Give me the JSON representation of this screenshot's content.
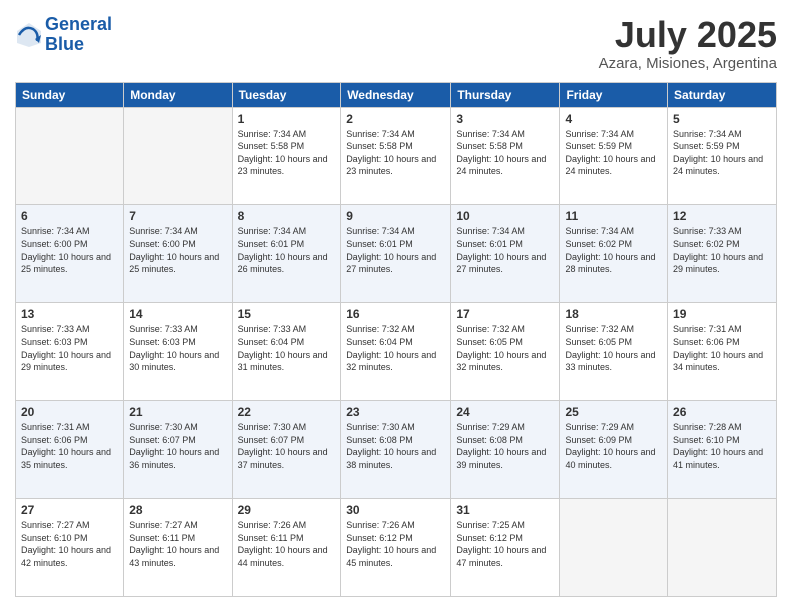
{
  "header": {
    "logo_line1": "General",
    "logo_line2": "Blue",
    "title": "July 2025",
    "subtitle": "Azara, Misiones, Argentina"
  },
  "days_of_week": [
    "Sunday",
    "Monday",
    "Tuesday",
    "Wednesday",
    "Thursday",
    "Friday",
    "Saturday"
  ],
  "weeks": [
    [
      {
        "day": "",
        "info": ""
      },
      {
        "day": "",
        "info": ""
      },
      {
        "day": "1",
        "info": "Sunrise: 7:34 AM\nSunset: 5:58 PM\nDaylight: 10 hours\nand 23 minutes."
      },
      {
        "day": "2",
        "info": "Sunrise: 7:34 AM\nSunset: 5:58 PM\nDaylight: 10 hours\nand 23 minutes."
      },
      {
        "day": "3",
        "info": "Sunrise: 7:34 AM\nSunset: 5:58 PM\nDaylight: 10 hours\nand 24 minutes."
      },
      {
        "day": "4",
        "info": "Sunrise: 7:34 AM\nSunset: 5:59 PM\nDaylight: 10 hours\nand 24 minutes."
      },
      {
        "day": "5",
        "info": "Sunrise: 7:34 AM\nSunset: 5:59 PM\nDaylight: 10 hours\nand 24 minutes."
      }
    ],
    [
      {
        "day": "6",
        "info": "Sunrise: 7:34 AM\nSunset: 6:00 PM\nDaylight: 10 hours\nand 25 minutes."
      },
      {
        "day": "7",
        "info": "Sunrise: 7:34 AM\nSunset: 6:00 PM\nDaylight: 10 hours\nand 25 minutes."
      },
      {
        "day": "8",
        "info": "Sunrise: 7:34 AM\nSunset: 6:01 PM\nDaylight: 10 hours\nand 26 minutes."
      },
      {
        "day": "9",
        "info": "Sunrise: 7:34 AM\nSunset: 6:01 PM\nDaylight: 10 hours\nand 27 minutes."
      },
      {
        "day": "10",
        "info": "Sunrise: 7:34 AM\nSunset: 6:01 PM\nDaylight: 10 hours\nand 27 minutes."
      },
      {
        "day": "11",
        "info": "Sunrise: 7:34 AM\nSunset: 6:02 PM\nDaylight: 10 hours\nand 28 minutes."
      },
      {
        "day": "12",
        "info": "Sunrise: 7:33 AM\nSunset: 6:02 PM\nDaylight: 10 hours\nand 29 minutes."
      }
    ],
    [
      {
        "day": "13",
        "info": "Sunrise: 7:33 AM\nSunset: 6:03 PM\nDaylight: 10 hours\nand 29 minutes."
      },
      {
        "day": "14",
        "info": "Sunrise: 7:33 AM\nSunset: 6:03 PM\nDaylight: 10 hours\nand 30 minutes."
      },
      {
        "day": "15",
        "info": "Sunrise: 7:33 AM\nSunset: 6:04 PM\nDaylight: 10 hours\nand 31 minutes."
      },
      {
        "day": "16",
        "info": "Sunrise: 7:32 AM\nSunset: 6:04 PM\nDaylight: 10 hours\nand 32 minutes."
      },
      {
        "day": "17",
        "info": "Sunrise: 7:32 AM\nSunset: 6:05 PM\nDaylight: 10 hours\nand 32 minutes."
      },
      {
        "day": "18",
        "info": "Sunrise: 7:32 AM\nSunset: 6:05 PM\nDaylight: 10 hours\nand 33 minutes."
      },
      {
        "day": "19",
        "info": "Sunrise: 7:31 AM\nSunset: 6:06 PM\nDaylight: 10 hours\nand 34 minutes."
      }
    ],
    [
      {
        "day": "20",
        "info": "Sunrise: 7:31 AM\nSunset: 6:06 PM\nDaylight: 10 hours\nand 35 minutes."
      },
      {
        "day": "21",
        "info": "Sunrise: 7:30 AM\nSunset: 6:07 PM\nDaylight: 10 hours\nand 36 minutes."
      },
      {
        "day": "22",
        "info": "Sunrise: 7:30 AM\nSunset: 6:07 PM\nDaylight: 10 hours\nand 37 minutes."
      },
      {
        "day": "23",
        "info": "Sunrise: 7:30 AM\nSunset: 6:08 PM\nDaylight: 10 hours\nand 38 minutes."
      },
      {
        "day": "24",
        "info": "Sunrise: 7:29 AM\nSunset: 6:08 PM\nDaylight: 10 hours\nand 39 minutes."
      },
      {
        "day": "25",
        "info": "Sunrise: 7:29 AM\nSunset: 6:09 PM\nDaylight: 10 hours\nand 40 minutes."
      },
      {
        "day": "26",
        "info": "Sunrise: 7:28 AM\nSunset: 6:10 PM\nDaylight: 10 hours\nand 41 minutes."
      }
    ],
    [
      {
        "day": "27",
        "info": "Sunrise: 7:27 AM\nSunset: 6:10 PM\nDaylight: 10 hours\nand 42 minutes."
      },
      {
        "day": "28",
        "info": "Sunrise: 7:27 AM\nSunset: 6:11 PM\nDaylight: 10 hours\nand 43 minutes."
      },
      {
        "day": "29",
        "info": "Sunrise: 7:26 AM\nSunset: 6:11 PM\nDaylight: 10 hours\nand 44 minutes."
      },
      {
        "day": "30",
        "info": "Sunrise: 7:26 AM\nSunset: 6:12 PM\nDaylight: 10 hours\nand 45 minutes."
      },
      {
        "day": "31",
        "info": "Sunrise: 7:25 AM\nSunset: 6:12 PM\nDaylight: 10 hours\nand 47 minutes."
      },
      {
        "day": "",
        "info": ""
      },
      {
        "day": "",
        "info": ""
      }
    ]
  ]
}
